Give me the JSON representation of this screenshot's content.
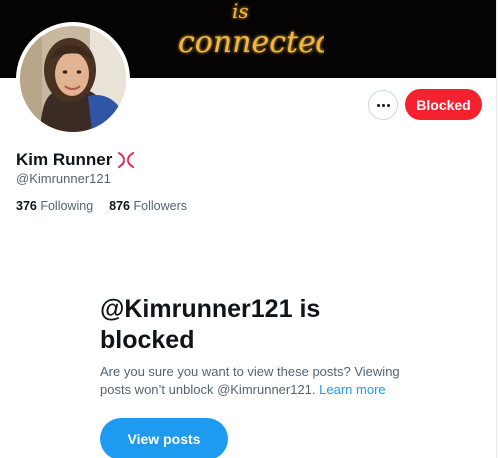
{
  "banner": {
    "neon_text": "connected",
    "neon_partial": "is"
  },
  "profile": {
    "display_name": "Kim Runner",
    "handle": "@Kimrunner121",
    "following_count": "376",
    "following_label": "Following",
    "followers_count": "876",
    "followers_label": "Followers"
  },
  "actions": {
    "blocked_label": "Blocked"
  },
  "blocked_notice": {
    "title": "@Kimrunner121 is blocked",
    "description": "Are you sure you want to view these posts? Viewing posts won’t unblock @Kimrunner121.",
    "learn_more": "Learn more",
    "view_posts_label": "View posts"
  },
  "colors": {
    "accent": "#1d9bf0",
    "blocked": "#f4212e",
    "neon": "#f3b741"
  }
}
